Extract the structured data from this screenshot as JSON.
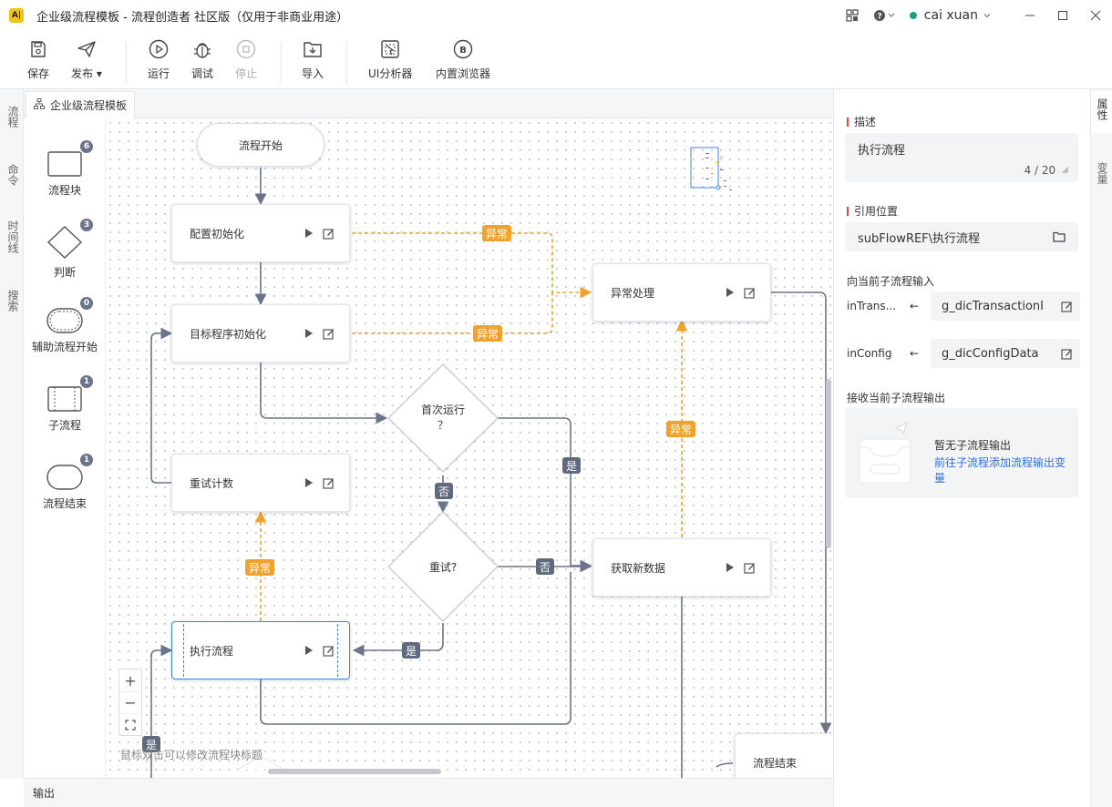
{
  "window": {
    "title": "企业级流程模板 - 流程创造者 社区版（仅用于非商业用途）",
    "user": "cai xuan",
    "status_color": "#18a27d"
  },
  "toolbar": {
    "save": "保存",
    "publish": "发布",
    "run": "运行",
    "debug": "调试",
    "stop": "停止",
    "import": "导入",
    "ui_analyzer": "UI分析器",
    "browser": "内置浏览器"
  },
  "left_tabs": [
    "流程",
    "命令",
    "时间线",
    "搜索"
  ],
  "doc_tab": "企业级流程模板",
  "palette": [
    {
      "label": "流程块",
      "count": "6",
      "icon": "rect-icon"
    },
    {
      "label": "判断",
      "count": "3",
      "icon": "diamond-icon"
    },
    {
      "label": "辅助流程开始",
      "count": "0",
      "icon": "stadium-icon"
    },
    {
      "label": "子流程",
      "count": "1",
      "icon": "subflow-icon"
    },
    {
      "label": "流程结束",
      "count": "1",
      "icon": "end-icon"
    }
  ],
  "canvas": {
    "start": "流程开始",
    "nodes": {
      "config_init": "配置初始化",
      "target_init": "目标程序初始化",
      "retry_count": "重试计数",
      "execute": "执行流程",
      "exception": "异常处理",
      "fetch": "获取新数据",
      "end": "流程结束"
    },
    "decisions": {
      "first_run_line1": "首次运行",
      "first_run_line2": "？",
      "retry": "重试?"
    },
    "edge_labels": {
      "exception": "异常",
      "yes": "是",
      "no": "否"
    },
    "hint": "鼠标双击可以修改流程块标题",
    "accent_orange": "#f0a22c",
    "edge_gray": "#6b7489"
  },
  "output_label": "输出",
  "right_tabs": [
    "属性",
    "变量"
  ],
  "props": {
    "desc_label": "描述",
    "desc_value": "执行流程",
    "desc_count": "4 / 20",
    "ref_label": "引用位置",
    "ref_value": "subFlowREF\\执行流程",
    "input_title": "向当前子流程输入",
    "inputs": [
      {
        "name": "inTrans...",
        "arrow": "←",
        "value": "g_dicTransactionI"
      },
      {
        "name": "inConfig",
        "arrow": "←",
        "value": "g_dicConfigData"
      }
    ],
    "output_title": "接收当前子流程输出",
    "empty_title": "暂无子流程输出",
    "empty_link": "前往子流程添加流程输出变量"
  }
}
